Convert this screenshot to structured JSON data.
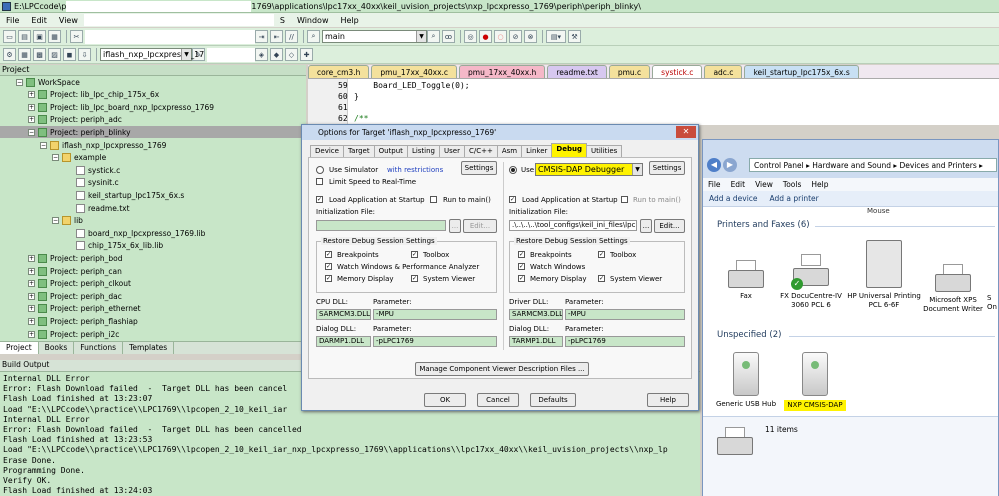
{
  "window": {
    "title_prefix": "E:\\LPCcode\\p",
    "title_suffix": "1769\\applications\\lpc17xx_40xx\\keil_uvision_projects\\nxp_lpcxpresso_1769\\periph\\periph_blinky\\"
  },
  "menu": [
    "File",
    "Edit",
    "View",
    "S",
    "Window",
    "Help"
  ],
  "toolbar": {
    "target_select": "iflash_nxp_lpcxpresso_17",
    "find_select": "main"
  },
  "project_panel": {
    "title": "Project",
    "tree": [
      {
        "label": "WorkSpace",
        "level": 0,
        "type": "proj"
      },
      {
        "label": "Project: lib_lpc_chip_175x_6x",
        "level": 1,
        "type": "proj"
      },
      {
        "label": "Project: lib_lpc_board_nxp_lpcxpresso_1769",
        "level": 1,
        "type": "proj"
      },
      {
        "label": "Project: periph_adc",
        "level": 1,
        "type": "proj"
      },
      {
        "label": "Project: periph_blinky",
        "level": 1,
        "type": "proj",
        "selected": true
      },
      {
        "label": "iflash_nxp_lpcxpresso_1769",
        "level": 2,
        "type": "folder"
      },
      {
        "label": "example",
        "level": 3,
        "type": "folder"
      },
      {
        "label": "systick.c",
        "level": 4,
        "type": "file"
      },
      {
        "label": "sysinit.c",
        "level": 4,
        "type": "file"
      },
      {
        "label": "keil_startup_lpc175x_6x.s",
        "level": 4,
        "type": "file"
      },
      {
        "label": "readme.txt",
        "level": 4,
        "type": "file"
      },
      {
        "label": "lib",
        "level": 3,
        "type": "folder"
      },
      {
        "label": "board_nxp_lpcxpresso_1769.lib",
        "level": 4,
        "type": "file"
      },
      {
        "label": "chip_175x_6x_lib.lib",
        "level": 4,
        "type": "file"
      },
      {
        "label": "Project: periph_bod",
        "level": 1,
        "type": "proj"
      },
      {
        "label": "Project: periph_can",
        "level": 1,
        "type": "proj"
      },
      {
        "label": "Project: periph_clkout",
        "level": 1,
        "type": "proj"
      },
      {
        "label": "Project: periph_dac",
        "level": 1,
        "type": "proj"
      },
      {
        "label": "Project: periph_ethernet",
        "level": 1,
        "type": "proj"
      },
      {
        "label": "Project: periph_flashiap",
        "level": 1,
        "type": "proj"
      },
      {
        "label": "Project: periph_i2c",
        "level": 1,
        "type": "proj"
      }
    ],
    "tabs": [
      "Project",
      "Books",
      "Functions",
      "Templates"
    ]
  },
  "editor": {
    "tabs": [
      {
        "label": "core_cm3.h",
        "color": "#f4e19c"
      },
      {
        "label": "pmu_17xx_40xx.c",
        "color": "#f4e19c"
      },
      {
        "label": "pmu_17xx_40xx.h",
        "color": "#f5b8c8"
      },
      {
        "label": "readme.txt",
        "color": "#d7c8f0"
      },
      {
        "label": "pmu.c",
        "color": "#f4e19c"
      },
      {
        "label": "systick.c",
        "color": "#f4e19c",
        "active": true
      },
      {
        "label": "adc.c",
        "color": "#f4e19c"
      },
      {
        "label": "keil_startup_lpc175x_6x.s",
        "color": "#c8e0f4"
      }
    ],
    "lines": [
      {
        "num": "59",
        "code": "    Board_LED_Toggle(0);"
      },
      {
        "num": "60",
        "code": "}"
      },
      {
        "num": "61",
        "code": ""
      },
      {
        "num": "62",
        "code": "/**"
      }
    ]
  },
  "build": {
    "title": "Build Output",
    "lines": [
      "Internal DLL Error",
      "Error: Flash Download failed  -  Target DLL has been cancel",
      "Flash Load finished at 13:23:07",
      "Load \"E:\\\\LPCcode\\\\practice\\\\LPC1769\\\\lpcopen_2_10_keil_iar",
      "Internal DLL Error",
      "Error: Flash Download failed  -  Target DLL has been cancelled",
      "Flash Load finished at 13:23:53",
      "Load \"E:\\\\LPCcode\\\\practice\\\\LPC1769\\\\lpcopen_2_10_keil_iar_nxp_lpcxpresso_1769\\\\applications\\\\lpc17xx_40xx\\\\keil_uvision_projects\\\\nxp_lp",
      "Erase Done.",
      "Programming Done.",
      "Verify OK.",
      "Flash Load finished at 13:24:03"
    ]
  },
  "dialog": {
    "title": "Options for Target 'iflash_nxp_lpcxpresso_1769'",
    "tabs": [
      "Device",
      "Target",
      "Output",
      "Listing",
      "User",
      "C/C++",
      "Asm",
      "Linker",
      "Debug",
      "Utilities"
    ],
    "active_tab": "Debug",
    "left": {
      "use_simulator": "Use Simulator",
      "with_restrictions": "with restrictions",
      "settings": "Settings",
      "limit_speed": "Limit Speed to Real-Time",
      "load_app": "Load Application at Startup",
      "run_to_main": "Run to main()",
      "init_file_label": "Initialization File:",
      "init_file": "",
      "edit": "Edit...",
      "browse": "...",
      "restore_title": "Restore Debug Session Settings",
      "breakpoints": "Breakpoints",
      "toolbox": "Toolbox",
      "watch": "Watch Windows & Performance Analyzer",
      "memory": "Memory Display",
      "system_viewer": "System Viewer",
      "cpu_dll_label": "CPU DLL:",
      "cpu_param_label": "Parameter:",
      "cpu_dll": "SARMCM3.DLL",
      "cpu_param": "-MPU",
      "dialog_dll_label": "Dialog DLL:",
      "dialog_param_label": "Parameter:",
      "dialog_dll": "DARMP1.DLL",
      "dialog_param": "-pLPC1769"
    },
    "right": {
      "use": "Use:",
      "debugger": "CMSIS-DAP Debugger",
      "settings": "Settings",
      "load_app": "Load Application at Startup",
      "run_to_main": "Run to main()",
      "init_file_label": "Initialization File:",
      "init_file": ".\\..\\..\\..\\tool_configs\\keil_ini_files\\lpc17",
      "edit": "Edit...",
      "browse": "...",
      "restore_title": "Restore Debug Session Settings",
      "breakpoints": "Breakpoints",
      "toolbox": "Toolbox",
      "watch": "Watch Windows",
      "memory": "Memory Display",
      "system_viewer": "System Viewer",
      "driver_dll_label": "Driver DLL:",
      "driver_param_label": "Parameter:",
      "driver_dll": "SARMCM3.DLL",
      "driver_param": "-MPU",
      "dialog_dll_label": "Dialog DLL:",
      "dialog_param_label": "Parameter:",
      "dialog_dll": "TARMP1.DLL",
      "dialog_param": "-pLPC1769"
    },
    "manage_btn": "Manage Component Viewer Description Files ...",
    "ok": "OK",
    "cancel": "Cancel",
    "defaults": "Defaults",
    "help": "Help"
  },
  "devices": {
    "address": "Control Panel  ▸  Hardware and Sound  ▸  Devices and Printers  ▸",
    "menu": [
      "File",
      "Edit",
      "View",
      "Tools",
      "Help"
    ],
    "commands": [
      "Add a device",
      "Add a printer"
    ],
    "mouse_caption": "Mouse",
    "printers_header": "Printers and Faxes (6)",
    "printers": [
      "Fax",
      "FX DocuCentre-IV 3060 PCL 6",
      "HP Universal Printing PCL 6-6F",
      "Microsoft XPS Document Writer",
      "S On"
    ],
    "unspecified_header": "Unspecified (2)",
    "unspecified": [
      "Generic USB Hub",
      "NXP CMSIS-DAP"
    ],
    "status": "11 items"
  }
}
